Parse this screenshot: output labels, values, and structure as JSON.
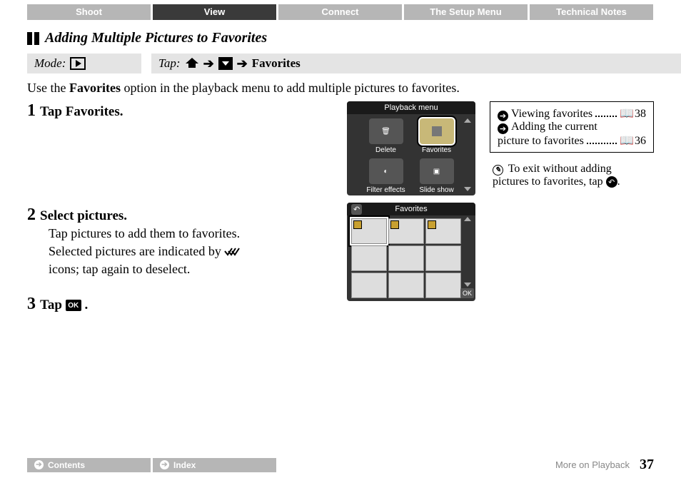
{
  "tabs": [
    "Shoot",
    "View",
    "Connect",
    "The Setup Menu",
    "Technical Notes"
  ],
  "active_tab_index": 1,
  "section_title": "Adding Multiple Pictures to Favorites",
  "mode": {
    "label": "Mode:"
  },
  "tap_path": {
    "label": "Tap:",
    "arrow": "➔",
    "target": "Favorites"
  },
  "intro": {
    "pre": "Use the ",
    "bold": "Favorites",
    "post": " option in the playback menu to add multiple pictures to favorites."
  },
  "steps": [
    {
      "num": "1",
      "title_pre": "Tap ",
      "title_bold": "Favorites.",
      "body": ""
    },
    {
      "num": "2",
      "title_pre": "",
      "title_bold": "Select pictures.",
      "body_line1": "Tap pictures to add them to favorites.",
      "body_line2_pre": "Selected pictures are indicated by ",
      "body_line3": "icons; tap again to deselect."
    },
    {
      "num": "3",
      "title_pre": "Tap ",
      "ok": "OK",
      "title_post": "."
    }
  ],
  "screen1": {
    "title": "Playback menu",
    "items": [
      "Delete",
      "Favorites",
      "Filter effects",
      "Slide show"
    ],
    "highlighted_index": 1
  },
  "screen2": {
    "title": "Favorites",
    "ok": "OK"
  },
  "refs": [
    {
      "text": "Viewing favorites",
      "page": "38"
    },
    {
      "text_line1": "Adding the current",
      "text_line2": "picture to favorites",
      "page": "36"
    }
  ],
  "note": {
    "line1": "To exit without adding",
    "line2_pre": "pictures to favorites, tap ",
    "line2_post": "."
  },
  "footer": {
    "contents": "Contents",
    "index": "Index",
    "section": "More on Playback",
    "page": "37"
  }
}
